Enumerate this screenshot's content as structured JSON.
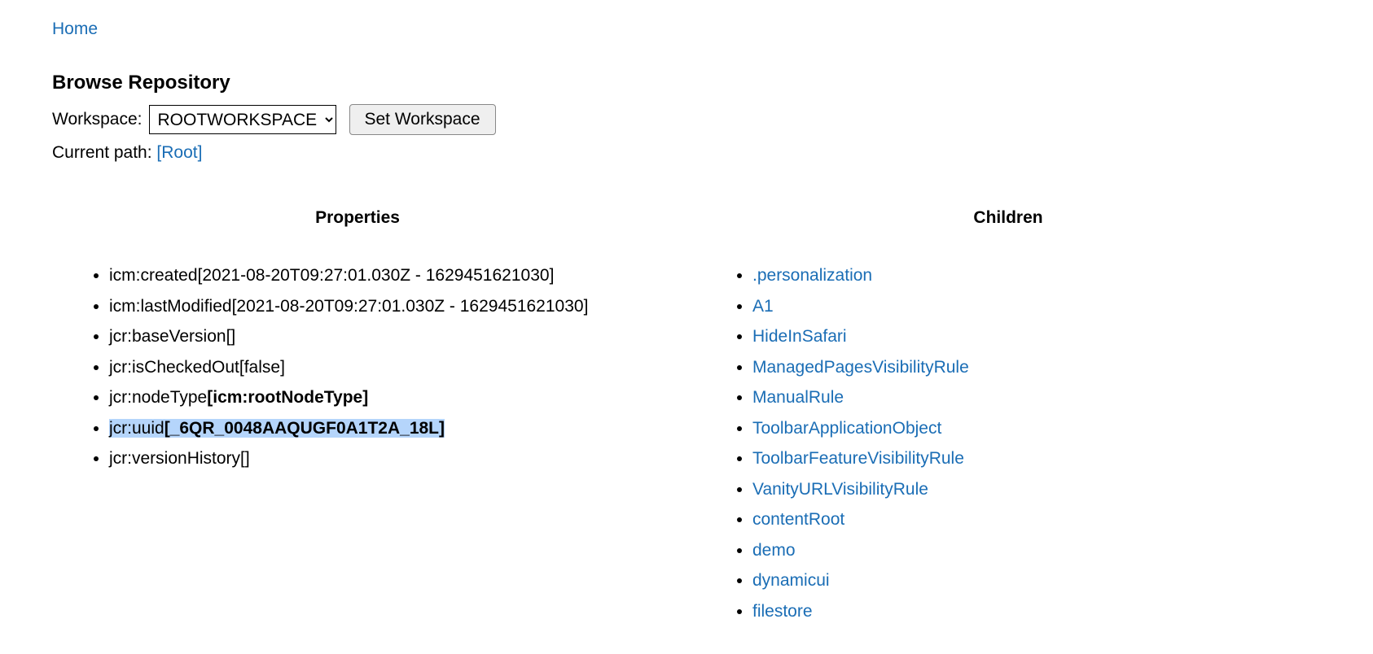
{
  "nav": {
    "home_label": "Home"
  },
  "page": {
    "title": "Browse Repository",
    "workspace_label": "Workspace:",
    "workspace_selected": "ROOTWORKSPACE",
    "set_workspace_label": "Set Workspace",
    "current_path_label": "Current path: ",
    "current_path_link": "[Root]"
  },
  "columns": {
    "properties_heading": "Properties",
    "children_heading": "Children"
  },
  "properties": [
    {
      "key": "icm:created",
      "value": "[2021-08-20T09:27:01.030Z - 1629451621030]",
      "bold": false,
      "highlighted": false
    },
    {
      "key": "icm:lastModified",
      "value": "[2021-08-20T09:27:01.030Z - 1629451621030]",
      "bold": false,
      "highlighted": false
    },
    {
      "key": "jcr:baseVersion",
      "value": "[]",
      "bold": false,
      "highlighted": false
    },
    {
      "key": "jcr:isCheckedOut",
      "value": "[false]",
      "bold": false,
      "highlighted": false
    },
    {
      "key": "jcr:nodeType",
      "value": "[icm:rootNodeType]",
      "bold": true,
      "highlighted": false
    },
    {
      "key": "jcr:uuid",
      "value": "[_6QR_0048AAQUGF0A1T2A_18L]",
      "bold": true,
      "highlighted": true
    },
    {
      "key": "jcr:versionHistory",
      "value": "[]",
      "bold": false,
      "highlighted": false
    }
  ],
  "children": [
    ".personalization",
    "A1",
    "HideInSafari",
    "ManagedPagesVisibilityRule",
    "ManualRule",
    "ToolbarApplicationObject",
    "ToolbarFeatureVisibilityRule",
    "VanityURLVisibilityRule",
    "contentRoot",
    "demo",
    "dynamicui",
    "filestore"
  ]
}
